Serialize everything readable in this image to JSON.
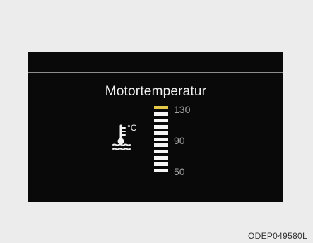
{
  "display": {
    "title": "Motortemperatur",
    "gauge": {
      "scale_labels": [
        "130",
        "90",
        "50"
      ],
      "segment_count": 11,
      "hot_segment_count": 1,
      "level_fraction": 1.0,
      "colors": {
        "segment": "#f5f5f5",
        "hot_segment": "#e4c84a",
        "background": "#090909"
      }
    },
    "coolant_icon_unit": "°C",
    "icon": "coolant-temperature-icon"
  },
  "footer": {
    "code": "ODEP049580L"
  }
}
